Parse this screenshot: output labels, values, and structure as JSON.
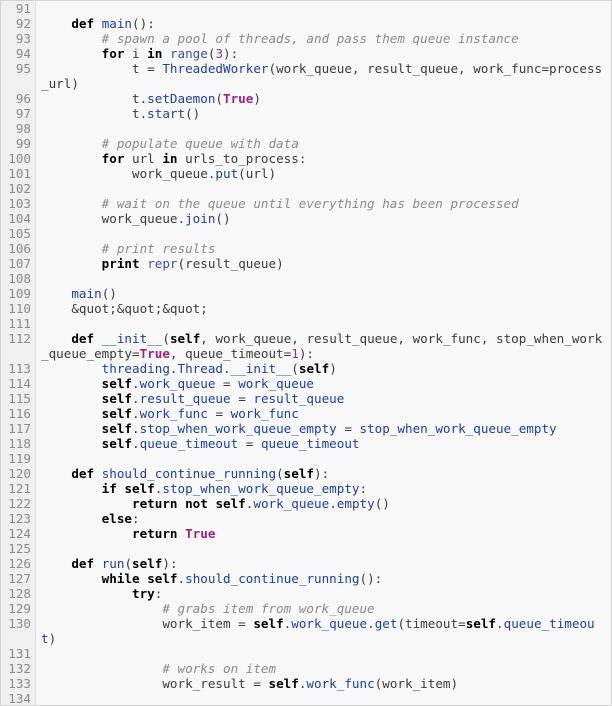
{
  "lines": [
    {
      "n": "91",
      "t": []
    },
    {
      "n": "92",
      "t": [
        [
          "    ",
          ""
        ],
        [
          "def",
          "kw"
        ],
        [
          " ",
          ""
        ],
        [
          "main",
          "fn"
        ],
        [
          "():",
          "pl"
        ]
      ]
    },
    {
      "n": "93",
      "t": [
        [
          "        ",
          ""
        ],
        [
          "# spawn a pool of threads, and pass them queue instance",
          "cm"
        ]
      ]
    },
    {
      "n": "94",
      "t": [
        [
          "        ",
          ""
        ],
        [
          "for",
          "kw"
        ],
        [
          " i ",
          ""
        ],
        [
          "in",
          "kw"
        ],
        [
          " ",
          ""
        ],
        [
          "range",
          "bi"
        ],
        [
          "(",
          "pl"
        ],
        [
          "3",
          "num"
        ],
        [
          "):",
          "pl"
        ]
      ]
    },
    {
      "n": "95",
      "t": [
        [
          "            t = ",
          ""
        ],
        [
          "ThreadedWorker",
          "fn"
        ],
        [
          "(work_queue, result_queue, work_func=process_url)",
          ""
        ]
      ]
    },
    {
      "n": "96",
      "t": [
        [
          "            t.",
          ""
        ],
        [
          "setDaemon",
          "fn"
        ],
        [
          "(",
          ""
        ],
        [
          "True",
          "tr"
        ],
        [
          ")",
          ""
        ]
      ]
    },
    {
      "n": "97",
      "t": [
        [
          "            t.",
          ""
        ],
        [
          "start",
          "fn"
        ],
        [
          "()",
          ""
        ]
      ]
    },
    {
      "n": "98",
      "t": []
    },
    {
      "n": "99",
      "t": [
        [
          "        ",
          ""
        ],
        [
          "# populate queue with data",
          "cm"
        ]
      ]
    },
    {
      "n": "100",
      "t": [
        [
          "        ",
          ""
        ],
        [
          "for",
          "kw"
        ],
        [
          " url ",
          ""
        ],
        [
          "in",
          "kw"
        ],
        [
          " urls_to_process:",
          ""
        ]
      ]
    },
    {
      "n": "101",
      "t": [
        [
          "            work_queue.",
          ""
        ],
        [
          "put",
          "fn"
        ],
        [
          "(url)",
          ""
        ]
      ]
    },
    {
      "n": "102",
      "t": []
    },
    {
      "n": "103",
      "t": [
        [
          "        ",
          ""
        ],
        [
          "# wait on the queue until everything has been processed",
          "cm"
        ]
      ]
    },
    {
      "n": "104",
      "t": [
        [
          "        work_queue.",
          ""
        ],
        [
          "join",
          "fn"
        ],
        [
          "()",
          ""
        ]
      ]
    },
    {
      "n": "105",
      "t": []
    },
    {
      "n": "106",
      "t": [
        [
          "        ",
          ""
        ],
        [
          "# print results",
          "cm"
        ]
      ]
    },
    {
      "n": "107",
      "t": [
        [
          "        ",
          ""
        ],
        [
          "print",
          "kw"
        ],
        [
          " ",
          ""
        ],
        [
          "repr",
          "bi"
        ],
        [
          "(result_queue)",
          ""
        ]
      ]
    },
    {
      "n": "108",
      "t": []
    },
    {
      "n": "109",
      "t": [
        [
          "    ",
          ""
        ],
        [
          "main",
          "fn"
        ],
        [
          "()",
          ""
        ]
      ]
    },
    {
      "n": "110",
      "t": [
        [
          "    &quot;&quot;&quot;",
          ""
        ]
      ]
    },
    {
      "n": "111",
      "t": []
    },
    {
      "n": "112",
      "t": [
        [
          "    ",
          ""
        ],
        [
          "def",
          "kw"
        ],
        [
          " ",
          ""
        ],
        [
          "__init__",
          "fn"
        ],
        [
          "(",
          ""
        ],
        [
          "self",
          "sf"
        ],
        [
          ", work_queue, result_queue, work_func, stop_when_work_queue_empty=",
          ""
        ],
        [
          "True",
          "tr"
        ],
        [
          ", queue_timeout=",
          ""
        ],
        [
          "1",
          "num"
        ],
        [
          "):",
          ""
        ]
      ]
    },
    {
      "n": "113",
      "t": [
        [
          "        ",
          ""
        ],
        [
          "threading",
          "fn"
        ],
        [
          ".",
          ""
        ],
        [
          "Thread",
          "fn"
        ],
        [
          ".",
          ""
        ],
        [
          "__init__",
          "fn"
        ],
        [
          "(",
          ""
        ],
        [
          "self",
          "sf"
        ],
        [
          ")",
          ""
        ]
      ]
    },
    {
      "n": "114",
      "t": [
        [
          "        ",
          ""
        ],
        [
          "self",
          "sf"
        ],
        [
          ".",
          ""
        ],
        [
          "work_queue",
          "fn"
        ],
        [
          " = ",
          ""
        ],
        [
          "work_queue",
          "fn"
        ]
      ]
    },
    {
      "n": "115",
      "t": [
        [
          "        ",
          ""
        ],
        [
          "self",
          "sf"
        ],
        [
          ".",
          ""
        ],
        [
          "result_queue",
          "fn"
        ],
        [
          " = ",
          ""
        ],
        [
          "result_queue",
          "fn"
        ]
      ]
    },
    {
      "n": "116",
      "t": [
        [
          "        ",
          ""
        ],
        [
          "self",
          "sf"
        ],
        [
          ".",
          ""
        ],
        [
          "work_func",
          "fn"
        ],
        [
          " = ",
          ""
        ],
        [
          "work_func",
          "fn"
        ]
      ]
    },
    {
      "n": "117",
      "t": [
        [
          "        ",
          ""
        ],
        [
          "self",
          "sf"
        ],
        [
          ".",
          ""
        ],
        [
          "stop_when_work_queue_empty",
          "fn"
        ],
        [
          " = ",
          ""
        ],
        [
          "stop_when_work_queue_empty",
          "fn"
        ]
      ]
    },
    {
      "n": "118",
      "t": [
        [
          "        ",
          ""
        ],
        [
          "self",
          "sf"
        ],
        [
          ".",
          ""
        ],
        [
          "queue_timeout",
          "fn"
        ],
        [
          " = ",
          ""
        ],
        [
          "queue_timeout",
          "fn"
        ]
      ]
    },
    {
      "n": "119",
      "t": []
    },
    {
      "n": "120",
      "t": [
        [
          "    ",
          ""
        ],
        [
          "def",
          "kw"
        ],
        [
          " ",
          ""
        ],
        [
          "should_continue_running",
          "fn"
        ],
        [
          "(",
          ""
        ],
        [
          "self",
          "sf"
        ],
        [
          "):",
          ""
        ]
      ]
    },
    {
      "n": "121",
      "t": [
        [
          "        ",
          ""
        ],
        [
          "if",
          "kw"
        ],
        [
          " ",
          ""
        ],
        [
          "self",
          "sf"
        ],
        [
          ".",
          ""
        ],
        [
          "stop_when_work_queue_empty",
          "fn"
        ],
        [
          ":",
          ""
        ]
      ]
    },
    {
      "n": "122",
      "t": [
        [
          "            ",
          ""
        ],
        [
          "return",
          "kw"
        ],
        [
          " ",
          ""
        ],
        [
          "not",
          "kw"
        ],
        [
          " ",
          ""
        ],
        [
          "self",
          "sf"
        ],
        [
          ".",
          ""
        ],
        [
          "work_queue",
          "fn"
        ],
        [
          ".",
          ""
        ],
        [
          "empty",
          "fn"
        ],
        [
          "()",
          ""
        ]
      ]
    },
    {
      "n": "123",
      "t": [
        [
          "        ",
          ""
        ],
        [
          "else",
          "kw"
        ],
        [
          ":",
          ""
        ]
      ]
    },
    {
      "n": "124",
      "t": [
        [
          "            ",
          ""
        ],
        [
          "return",
          "kw"
        ],
        [
          " ",
          ""
        ],
        [
          "True",
          "tr"
        ]
      ]
    },
    {
      "n": "125",
      "t": []
    },
    {
      "n": "126",
      "t": [
        [
          "    ",
          ""
        ],
        [
          "def",
          "kw"
        ],
        [
          " ",
          ""
        ],
        [
          "run",
          "fn"
        ],
        [
          "(",
          ""
        ],
        [
          "self",
          "sf"
        ],
        [
          "):",
          ""
        ]
      ]
    },
    {
      "n": "127",
      "t": [
        [
          "        ",
          ""
        ],
        [
          "while",
          "kw"
        ],
        [
          " ",
          ""
        ],
        [
          "self",
          "sf"
        ],
        [
          ".",
          ""
        ],
        [
          "should_continue_running",
          "fn"
        ],
        [
          "():",
          ""
        ]
      ]
    },
    {
      "n": "128",
      "t": [
        [
          "            ",
          ""
        ],
        [
          "try",
          "kw"
        ],
        [
          ":",
          ""
        ]
      ]
    },
    {
      "n": "129",
      "t": [
        [
          "                ",
          ""
        ],
        [
          "# grabs item from work_queue",
          "cm"
        ]
      ]
    },
    {
      "n": "130",
      "t": [
        [
          "                work_item = ",
          ""
        ],
        [
          "self",
          "sf"
        ],
        [
          ".",
          ""
        ],
        [
          "work_queue",
          "fn"
        ],
        [
          ".",
          ""
        ],
        [
          "get",
          "fn"
        ],
        [
          "(timeout=",
          ""
        ],
        [
          "self",
          "sf"
        ],
        [
          ".",
          ""
        ],
        [
          "queue_timeout",
          "fn"
        ],
        [
          ")",
          ""
        ]
      ]
    },
    {
      "n": "131",
      "t": []
    },
    {
      "n": "132",
      "t": [
        [
          "                ",
          ""
        ],
        [
          "# works on item",
          "cm"
        ]
      ]
    },
    {
      "n": "133",
      "t": [
        [
          "                work_result = ",
          ""
        ],
        [
          "self",
          "sf"
        ],
        [
          ".",
          ""
        ],
        [
          "work_func",
          "fn"
        ],
        [
          "(work_item)",
          ""
        ]
      ]
    },
    {
      "n": "134",
      "t": []
    }
  ]
}
